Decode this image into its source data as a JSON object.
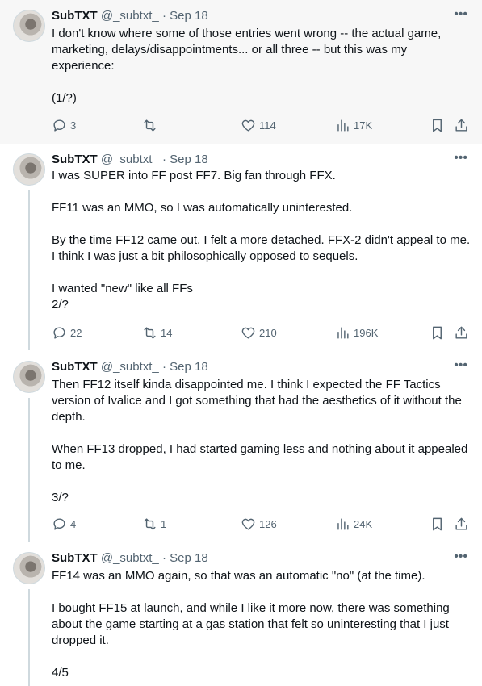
{
  "author": {
    "name": "SubTXT",
    "handle": "@_subtxt_",
    "date": "Sep 18"
  },
  "tweets": [
    {
      "paragraphs": [
        "I don't know where some of those entries went wrong -- the actual game, marketing, delays/disappointments... or all three -- but this was my experience:",
        "(1/?)"
      ],
      "replies": "3",
      "reposts": "",
      "likes": "114",
      "views": "17K"
    },
    {
      "paragraphs": [
        "I was SUPER into FF post FF7. Big fan through FFX.",
        "FF11 was an MMO, so I was automatically uninterested.",
        "By the time FF12 came out, I felt a more detached. FFX-2 didn't appeal to me. I think I was just a bit philosophically opposed to sequels.",
        "I wanted \"new\" like all FFs\n2/?"
      ],
      "replies": "22",
      "reposts": "14",
      "likes": "210",
      "views": "196K"
    },
    {
      "paragraphs": [
        "Then FF12 itself kinda disappointed me. I think I expected the FF Tactics version of Ivalice and I got something that had the aesthetics of it without the depth.",
        "When FF13 dropped, I had started gaming less and nothing about it appealed to me.",
        "3/?"
      ],
      "replies": "4",
      "reposts": "1",
      "likes": "126",
      "views": "24K"
    },
    {
      "paragraphs": [
        "FF14 was an MMO again, so that was an automatic \"no\" (at the time).",
        "I bought FF15 at launch, and while I like it more now, there was something about the game starting at a gas station that felt so uninteresting that I just dropped it.",
        "4/5"
      ]
    }
  ],
  "icons": {
    "reply": "reply-icon",
    "repost": "repost-icon",
    "like": "like-icon",
    "views": "views-icon",
    "bookmark": "bookmark-icon",
    "share": "share-icon",
    "more": "more-icon"
  }
}
